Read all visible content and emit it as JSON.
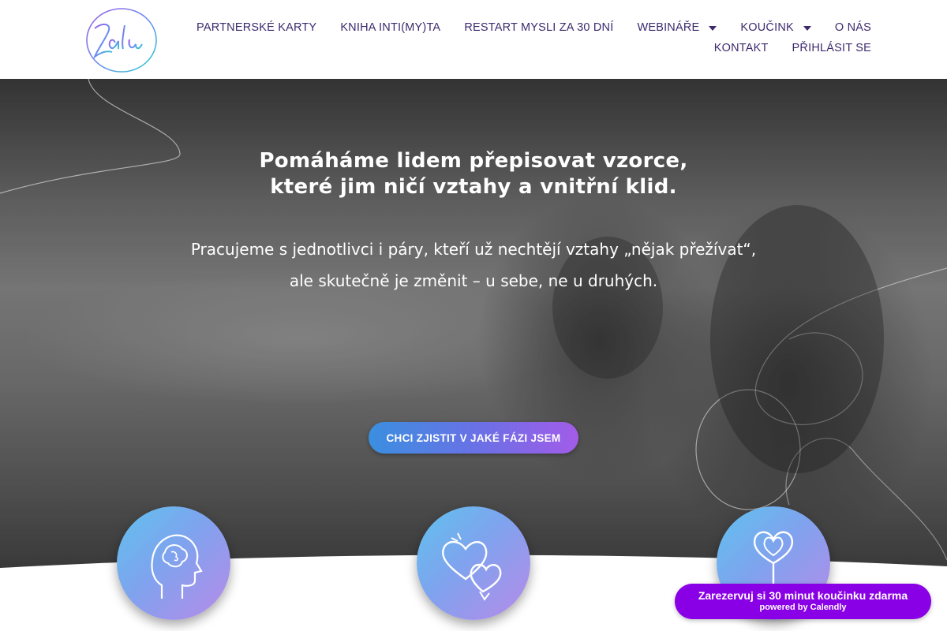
{
  "logo": {
    "text": "Zalu",
    "icon": "zalu-logo"
  },
  "nav": {
    "row1": [
      {
        "label": "PARTNERSKÉ KARTY",
        "dropdown": false
      },
      {
        "label": "KNIHA INTI(MY)TA",
        "dropdown": false
      },
      {
        "label": "RESTART MYSLI ZA 30 DNÍ",
        "dropdown": false
      },
      {
        "label": "WEBINÁŘE",
        "dropdown": true
      },
      {
        "label": "KOUČINK",
        "dropdown": true
      },
      {
        "label": "O NÁS",
        "dropdown": false
      }
    ],
    "row2": [
      {
        "label": "KONTAKT",
        "dropdown": false
      },
      {
        "label": "PŘIHLÁSIT SE",
        "dropdown": false
      }
    ]
  },
  "hero": {
    "title_line1": "Pomáháme lidem přepisovat vzorce,",
    "title_line2": "které jim ničí vztahy a vnitřní klid.",
    "sub_line1": "Pracujeme s jednotlivci i páry, kteří už nechtějí vztahy „nějak přežívat“,",
    "sub_line2": "ale skutečně je změnit – u sebe, ne u druhých.",
    "cta_label": "CHCI ZJISTIT V JAKÉ FÁZI JSEM"
  },
  "features": [
    {
      "icon": "head-brain-icon"
    },
    {
      "icon": "two-hearts-icon"
    },
    {
      "icon": "heart-key-icon"
    }
  ],
  "calendly": {
    "main": "Zarezervuj si 30 minut koučinku zdarma",
    "sub": "powered by Calendly"
  },
  "colors": {
    "nav_text": "#3d2a6e",
    "cta_gradient_start": "#3a8fe0",
    "cta_gradient_end": "#a25ce8",
    "calendly_bg": "#8a00e6",
    "circle_start": "#5fc2ef",
    "circle_end": "#b78ae9"
  }
}
